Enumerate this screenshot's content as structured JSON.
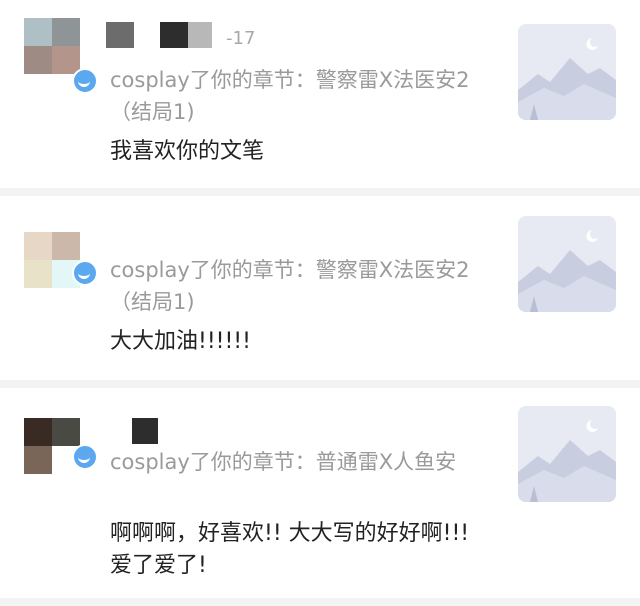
{
  "notifications": [
    {
      "time": "-17",
      "subline": "cosplay了你的章节：警察雷X法医安2（结局1)",
      "comment": "我喜欢你的文笔",
      "thumbnail_icon": "landscape-placeholder-icon"
    },
    {
      "subline": "cosplay了你的章节：警察雷X法医安2（结局1)",
      "comment": "大大加油!!!!!!",
      "thumbnail_icon": "landscape-placeholder-icon"
    },
    {
      "subline": "cosplay了你的章节：普通雷X人鱼安",
      "comment": "啊啊啊，好喜欢!! 大大写的好好啊!!! 爱了爱了!",
      "thumbnail_icon": "landscape-placeholder-icon"
    }
  ],
  "colors": {
    "background": "#f3f3f3",
    "card": "#ffffff",
    "secondary_text": "#9a9a9a",
    "primary_text": "#222222",
    "badge": "#5ba8f0"
  }
}
